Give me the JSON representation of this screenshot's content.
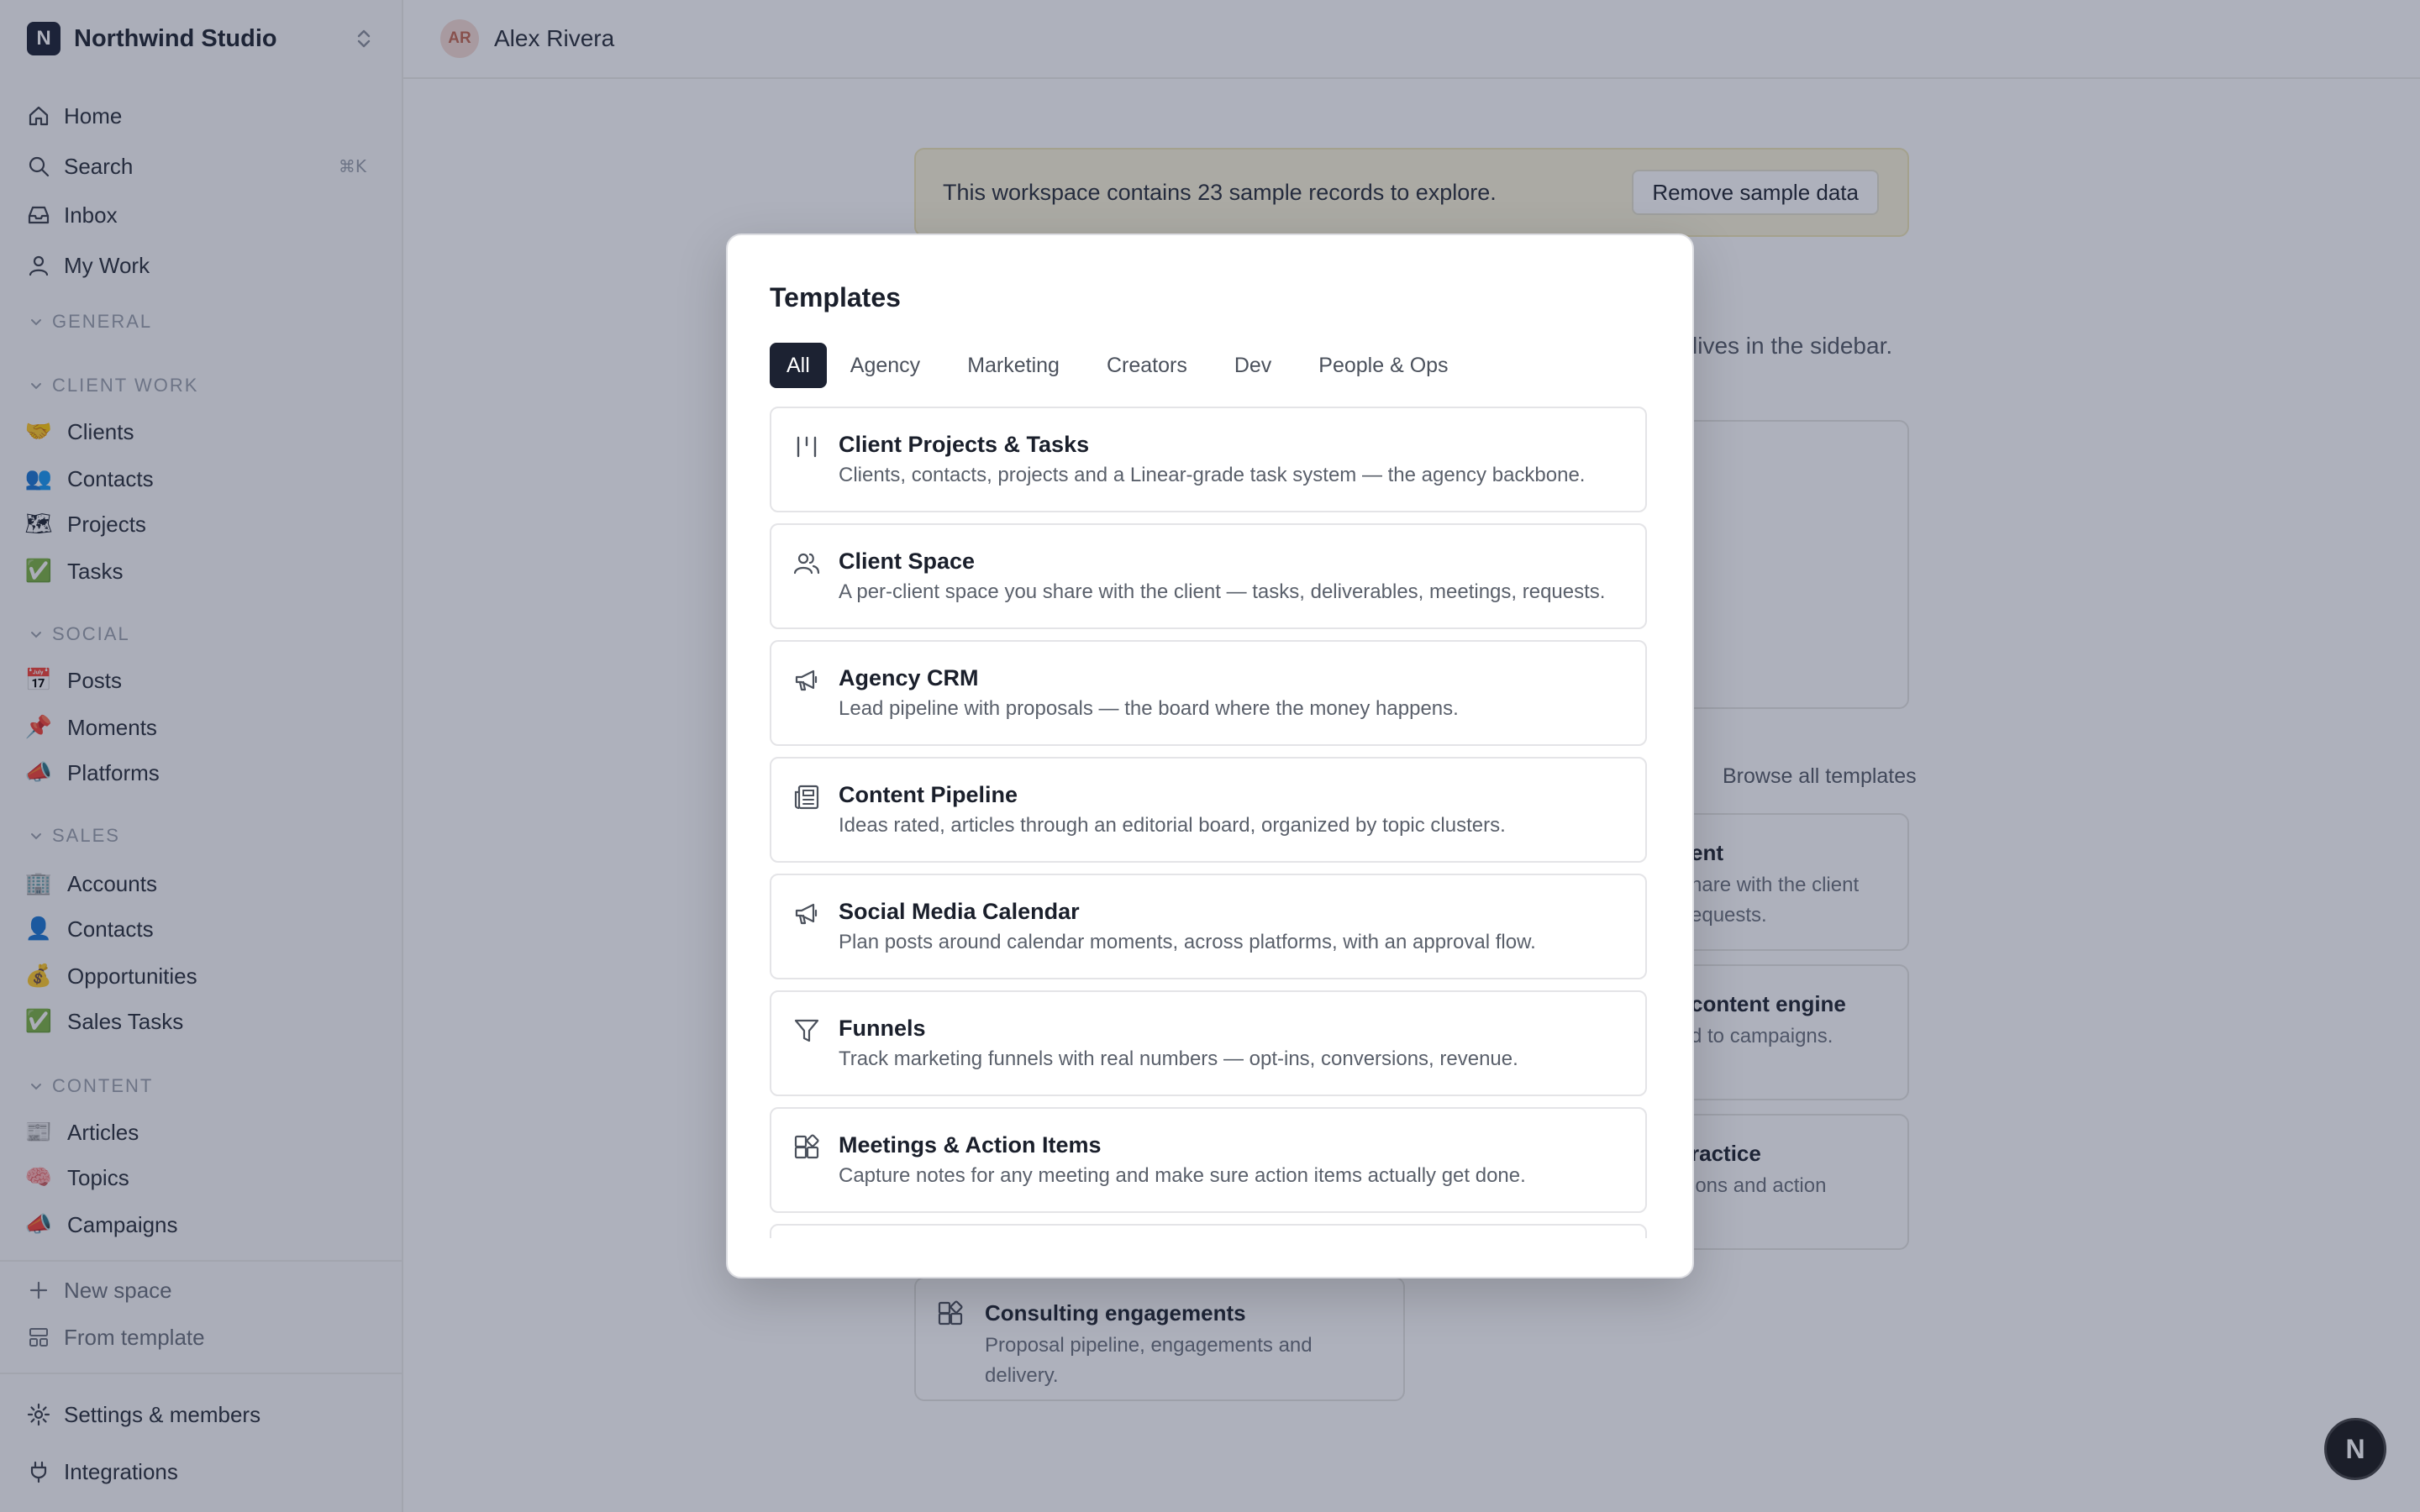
{
  "workspace": {
    "initial": "N",
    "name": "Northwind Studio"
  },
  "nav": {
    "home": "Home",
    "search": "Search",
    "search_shortcut": "⌘K",
    "inbox": "Inbox",
    "my_work": "My Work"
  },
  "sections": {
    "general": "GENERAL",
    "client_work": {
      "title": "CLIENT WORK",
      "items": [
        {
          "emoji": "🤝",
          "label": "Clients"
        },
        {
          "emoji": "👥",
          "label": "Contacts"
        },
        {
          "emoji": "🗺",
          "label": "Projects"
        },
        {
          "emoji": "✅",
          "label": "Tasks"
        }
      ]
    },
    "social": {
      "title": "SOCIAL",
      "items": [
        {
          "emoji": "📅",
          "label": "Posts"
        },
        {
          "emoji": "📌",
          "label": "Moments"
        },
        {
          "emoji": "📣",
          "label": "Platforms"
        }
      ]
    },
    "sales": {
      "title": "SALES",
      "items": [
        {
          "emoji": "🏢",
          "label": "Accounts"
        },
        {
          "emoji": "👤",
          "label": "Contacts"
        },
        {
          "emoji": "💰",
          "label": "Opportunities"
        },
        {
          "emoji": "✅",
          "label": "Sales Tasks"
        }
      ]
    },
    "content": {
      "title": "CONTENT",
      "items": [
        {
          "emoji": "📰",
          "label": "Articles"
        },
        {
          "emoji": "🧠",
          "label": "Topics"
        },
        {
          "emoji": "📣",
          "label": "Campaigns"
        }
      ]
    }
  },
  "sidebar_actions": {
    "new_space": "New space",
    "from_template": "From template",
    "settings": "Settings & members",
    "integrations": "Integrations"
  },
  "topbar": {
    "avatar_initials": "AR",
    "user_name": "Alex Rivera"
  },
  "banner": {
    "text": "This workspace contains 23 sample records to explore.",
    "button": "Remove sample data"
  },
  "background": {
    "subtitle_fragment": "l lives in the sidebar.",
    "browse_all": "Browse all templates",
    "card1": {
      "title": "ent",
      "desc1": "hare with the client",
      "desc2": "equests."
    },
    "card2": {
      "title": "content engine",
      "desc1": "d to campaigns."
    },
    "card3": {
      "title": "ractice",
      "desc1": "ions and action"
    },
    "consulting": {
      "title": "Consulting engagements",
      "desc": "Proposal pipeline, engagements and delivery."
    }
  },
  "modal": {
    "title": "Templates",
    "tabs": [
      "All",
      "Agency",
      "Marketing",
      "Creators",
      "Dev",
      "People & Ops"
    ],
    "active_tab": "All",
    "templates": [
      {
        "icon": "kanban-icon",
        "title": "Client Projects & Tasks",
        "desc": "Clients, contacts, projects and a Linear-grade task system — the agency backbone."
      },
      {
        "icon": "users-icon",
        "title": "Client Space",
        "desc": "A per-client space you share with the client — tasks, deliverables, meetings, requests."
      },
      {
        "icon": "megaphone-icon",
        "title": "Agency CRM",
        "desc": "Lead pipeline with proposals — the board where the money happens."
      },
      {
        "icon": "newspaper-icon",
        "title": "Content Pipeline",
        "desc": "Ideas rated, articles through an editorial board, organized by topic clusters."
      },
      {
        "icon": "megaphone-icon",
        "title": "Social Media Calendar",
        "desc": "Plan posts around calendar moments, across platforms, with an approval flow."
      },
      {
        "icon": "funnel-icon",
        "title": "Funnels",
        "desc": "Track marketing funnels with real numbers — opt-ins, conversions, revenue."
      },
      {
        "icon": "blocks-icon",
        "title": "Meetings & Action Items",
        "desc": "Capture notes for any meeting and make sure action items actually get done."
      }
    ]
  },
  "fab": {
    "label": "N"
  },
  "colors": {
    "accent_dark": "#1c2232",
    "banner_bg": "#fbf5d9",
    "overlay": "rgba(30,40,70,0.36)"
  }
}
